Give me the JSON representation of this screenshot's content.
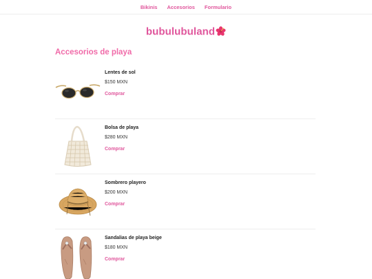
{
  "nav": {
    "items": [
      {
        "label": "Bikinis"
      },
      {
        "label": "Accesorios"
      },
      {
        "label": "Formulario"
      }
    ]
  },
  "brand": {
    "name": "bubulubuland",
    "icon": "hibiscus-icon"
  },
  "section": {
    "title": "Accesorios de playa"
  },
  "products": [
    {
      "name": "Lentes de sol",
      "price": "$150 MXN",
      "buy_label": "Comprar",
      "image": "sunglasses"
    },
    {
      "name": "Bolsa de playa",
      "price": "$280 MXN",
      "buy_label": "Comprar",
      "image": "beach-bag"
    },
    {
      "name": "Sombrero playero",
      "price": "$200 MXN",
      "buy_label": "Comprar",
      "image": "straw-hat"
    },
    {
      "name": "Sandalias de playa beige",
      "price": "$180 MXN",
      "buy_label": "Comprar",
      "image": "sandals"
    }
  ],
  "colors": {
    "accent": "#e0569c",
    "section_title": "#f06aa8",
    "divider": "#eeeeee"
  }
}
